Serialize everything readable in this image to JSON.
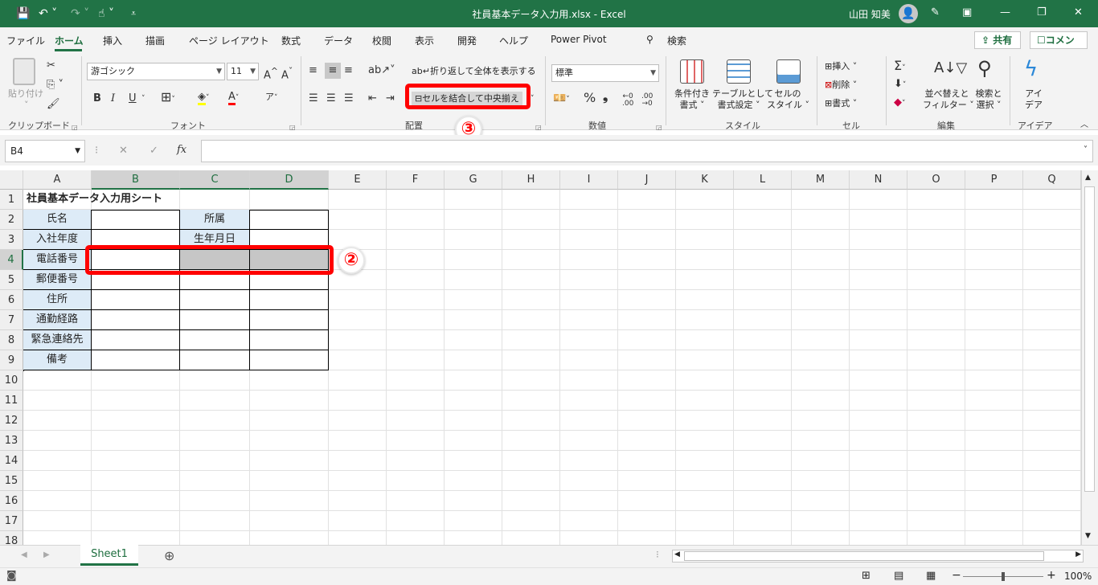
{
  "titlebar": {
    "title": "社員基本データ入力用.xlsx  -  Excel",
    "user": "山田 知美",
    "icons": [
      "save-icon",
      "undo-icon",
      "redo-icon",
      "touch-mode-icon",
      "customize-icon",
      "avatar-icon",
      "pen-icon",
      "ribbon-display-icon",
      "minimize-icon",
      "restore-icon",
      "close-icon"
    ]
  },
  "tabs": [
    "ファイル",
    "ホーム",
    "挿入",
    "描画",
    "ページ レイアウト",
    "数式",
    "データ",
    "校閲",
    "表示",
    "開発",
    "ヘルプ",
    "Power Pivot"
  ],
  "search_label": "検索",
  "share_label": "共有",
  "comment_label": "コメント",
  "ribbon": {
    "clipboard": {
      "paste": "貼り付け",
      "label": "クリップボード"
    },
    "font": {
      "name": "游ゴシック",
      "size": "11",
      "label": "フォント",
      "bold": "B",
      "italic": "I",
      "underline": "U",
      "grow": "A",
      "shrink": "A"
    },
    "alignment": {
      "wrap": "折り返して全体を表示する",
      "merge": "セルを結合して中央揃え",
      "label": "配置"
    },
    "number": {
      "format": "標準",
      "label": "数値",
      "percent": "%",
      "comma": "❟"
    },
    "styles": {
      "conditional": [
        "条件付き",
        "書式"
      ],
      "table": [
        "テーブルとして",
        "書式設定"
      ],
      "cell": [
        "セルの",
        "スタイル"
      ],
      "label": "スタイル"
    },
    "cells": {
      "insert": "挿入",
      "delete": "削除",
      "format": "書式",
      "label": "セル"
    },
    "editing": {
      "sort": [
        "並べ替えと",
        "フィルター"
      ],
      "find": [
        "検索と",
        "選択"
      ],
      "label": "編集"
    },
    "ideas": {
      "text": [
        "アイ",
        "デア"
      ],
      "label": "アイデア"
    }
  },
  "formula_bar": {
    "namebox": "B4",
    "cancel": "✕",
    "enter": "✓",
    "fx": "fx",
    "formula": ""
  },
  "columns": [
    "A",
    "B",
    "C",
    "D",
    "E",
    "F",
    "G",
    "H",
    "I",
    "J",
    "K",
    "L",
    "M",
    "N",
    "O",
    "P",
    "Q"
  ],
  "rows": [
    "1",
    "2",
    "3",
    "4",
    "5",
    "6",
    "7",
    "8",
    "9",
    "10",
    "11",
    "12",
    "13",
    "14",
    "15",
    "16",
    "17",
    "18"
  ],
  "selected_cell": "B4",
  "cells": {
    "A1": "社員基本データ入力用シート",
    "A2": "氏名",
    "C2": "所属",
    "A3": "入社年度",
    "C3": "生年月日",
    "A4": "電話番号",
    "A5": "郵便番号",
    "A6": "住所",
    "A7": "通勤経路",
    "A8": "緊急連絡先",
    "A9": "備考"
  },
  "callouts": {
    "step2": "②",
    "step3": "③"
  },
  "sheet_tab": "Sheet1",
  "zoom": "100%",
  "highlight_color": "#ff0000",
  "accent": "#217346"
}
